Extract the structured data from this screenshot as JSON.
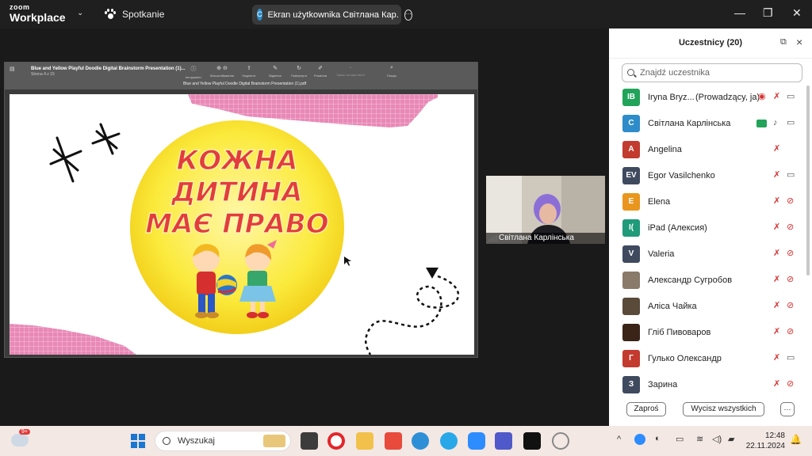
{
  "app": {
    "logo_top": "zoom",
    "logo_bottom": "Workplace",
    "meeting_label": "Spotkanie",
    "share_pill_initial": "С",
    "share_pill_text": "Ekran użytkownika Світлана Кар.",
    "share_pill_more": "···",
    "win_min": "—",
    "win_max": "❐",
    "win_close": "✕"
  },
  "shared_window": {
    "doc_title": "Blue and Yellow Playful Doodle Digital Brainstorm Presentation (1)...",
    "page_info": "Strona 4 z 15",
    "file_name": "Blue and Yellow Playful Doodle Digital Brainstorm Presentation (1).pdf",
    "toolbar": [
      "Інструмент",
      "Масштабування",
      "Наділити",
      "Відмітка",
      "Повернути",
      "Розмітка",
      "Запис на кристанні",
      "Пошук"
    ],
    "slide_text": [
      "КОЖНА",
      "ДИТИНА",
      "МАЄ ПРАВО"
    ]
  },
  "video": {
    "name": "Світлана Карлінська"
  },
  "participants_panel": {
    "title": "Uczestnicy (20)",
    "search_placeholder": "Znajdź uczestnika",
    "invite_label": "Zaproś",
    "mute_all_label": "Wycisz wszystkich",
    "more_label": "···",
    "participants": [
      {
        "initials": "IB",
        "name": "Iryna Bryz...",
        "role": "(Prowadzący, ja)",
        "color": "#22a35a",
        "mic": "off",
        "cam": "on"
      },
      {
        "initials": "С",
        "name": "Світлана Карлінська",
        "role": "",
        "color": "#2d8cc9",
        "mic": "on",
        "cam": "on"
      },
      {
        "initials": "A",
        "name": "Angelina",
        "role": "",
        "color": "#c33a2f",
        "mic": "off",
        "cam": "none"
      },
      {
        "initials": "EV",
        "name": "Egor Vasilchenko",
        "role": "",
        "color": "#3f4a5e",
        "mic": "off",
        "cam": "on"
      },
      {
        "initials": "E",
        "name": "Elena",
        "role": "",
        "color": "#e9961e",
        "mic": "off",
        "cam": "off"
      },
      {
        "initials": "I(",
        "name": "iPad (Алексия)",
        "role": "",
        "color": "#1f9a7a",
        "mic": "off",
        "cam": "off"
      },
      {
        "initials": "V",
        "name": "Valeria",
        "role": "",
        "color": "#3f4a5e",
        "mic": "off",
        "cam": "off"
      },
      {
        "initials": "",
        "name": "Александр Сугробов",
        "role": "",
        "color": "#8a7a6a",
        "mic": "off",
        "cam": "off"
      },
      {
        "initials": "",
        "name": "Аліса Чайка",
        "role": "",
        "color": "#5a4a3a",
        "mic": "off",
        "cam": "off"
      },
      {
        "initials": "",
        "name": "Гліб Пивоваров",
        "role": "",
        "color": "#3a2418",
        "mic": "off",
        "cam": "off"
      },
      {
        "initials": "Г",
        "name": "Гулько Олександр",
        "role": "",
        "color": "#c33a2f",
        "mic": "off",
        "cam": "on"
      },
      {
        "initials": "З",
        "name": "Зарина",
        "role": "",
        "color": "#3f4a5e",
        "mic": "off",
        "cam": "off"
      }
    ]
  },
  "taskbar": {
    "search_label": "Wyszukaj",
    "weather_badge": "9+",
    "time": "12:48",
    "date": "22.11.2024"
  }
}
